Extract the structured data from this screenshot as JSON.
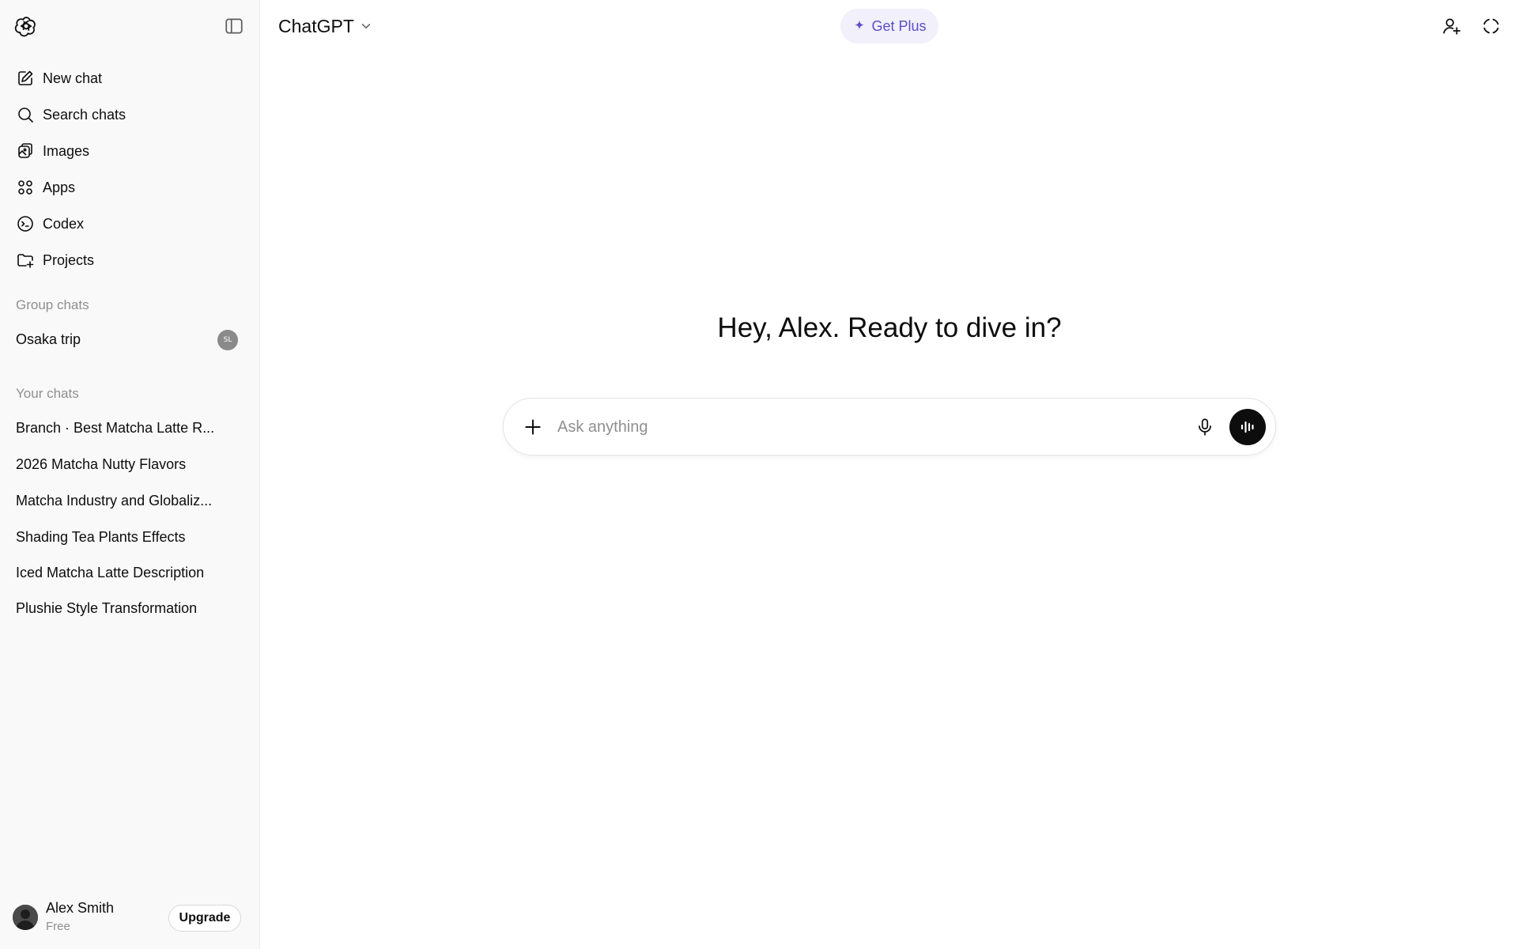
{
  "app": {
    "title": "ChatGPT"
  },
  "header": {
    "model_label": "ChatGPT",
    "get_plus_label": "Get Plus"
  },
  "sidebar": {
    "nav": [
      {
        "label": "New chat",
        "icon": "edit-icon"
      },
      {
        "label": "Search chats",
        "icon": "search-icon"
      },
      {
        "label": "Images",
        "icon": "images-icon"
      },
      {
        "label": "Apps",
        "icon": "apps-icon"
      },
      {
        "label": "Codex",
        "icon": "codex-icon"
      },
      {
        "label": "Projects",
        "icon": "folder-plus-icon"
      }
    ],
    "group_chats_label": "Group chats",
    "group_chats": [
      {
        "label": "Osaka trip",
        "avatar_initials": "SL"
      }
    ],
    "your_chats_label": "Your chats",
    "chats": [
      "Branch · Best Matcha Latte R...",
      "2026 Matcha Nutty Flavors",
      "Matcha Industry and Globaliz...",
      "Shading Tea Plants Effects",
      "Iced Matcha Latte Description",
      "Plushie Style Transformation"
    ],
    "user": {
      "name": "Alex Smith",
      "plan": "Free",
      "upgrade_label": "Upgrade"
    }
  },
  "main": {
    "greeting": "Hey, Alex. Ready to dive in?",
    "composer": {
      "placeholder": "Ask anything",
      "value": ""
    }
  },
  "colors": {
    "sidebar_bg": "#f9f9f9",
    "accent_plus": "#5b4fc8",
    "plus_bg": "#f1f0fb",
    "text": "#0d0d0d",
    "muted": "#8f8f8f"
  }
}
